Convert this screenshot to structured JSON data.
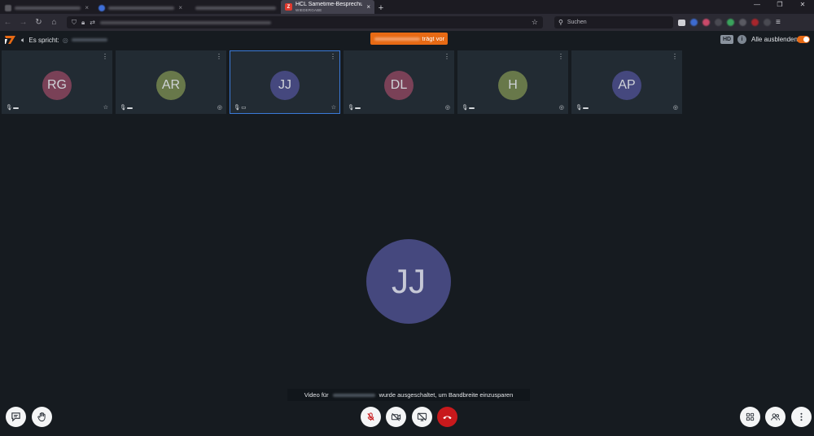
{
  "browser": {
    "active_tab": {
      "title": "HCL Sametime-Besprechungen",
      "subtitle": "WIEDERGABE",
      "favicon": "sametime-icon",
      "close": "×"
    },
    "new_tab_label": "+",
    "window_controls": {
      "minimize": "—",
      "restore": "❐",
      "close": "✕"
    },
    "search_placeholder": "Suchen"
  },
  "meeting": {
    "speaking_label": "Es spricht:",
    "presenter_suffix": "trägt vor",
    "hd_label": "HD",
    "info_label": "i",
    "hide_all_label": "Alle ausblenden",
    "hide_all_enabled": true,
    "accent_color": "#e76a14"
  },
  "participants": [
    {
      "initials": "RG",
      "color": "#7a4157",
      "corner_icon": "star-icon",
      "corner_glyph": "☆",
      "active": false
    },
    {
      "initials": "AR",
      "color": "#68784a",
      "corner_icon": "moderator-icon",
      "corner_glyph": "◎",
      "active": false
    },
    {
      "initials": "JJ",
      "color": "#45487e",
      "corner_icon": "star-icon",
      "corner_glyph": "☆",
      "active": true
    },
    {
      "initials": "DL",
      "color": "#7a4157",
      "corner_icon": "moderator-icon",
      "corner_glyph": "◎",
      "active": false
    },
    {
      "initials": "H",
      "color": "#68784a",
      "corner_icon": "moderator-icon",
      "corner_glyph": "◎",
      "active": false
    },
    {
      "initials": "AP",
      "color": "#45487e",
      "corner_icon": "moderator-icon",
      "corner_glyph": "◎",
      "active": false
    }
  ],
  "main_stage": {
    "initials": "JJ",
    "banner_prefix": "Video für",
    "banner_suffix": "wurde ausgeschaltet, um Bandbreite einzusparen"
  },
  "controls": {
    "left": [
      "chat-icon",
      "raise-hand-icon"
    ],
    "center": [
      "mic-off-icon",
      "camera-off-icon",
      "screen-share-off-icon",
      "hangup-icon"
    ],
    "right": [
      "layout-grid-icon",
      "participants-icon",
      "more-icon"
    ],
    "hangup_color": "#c8191c"
  }
}
